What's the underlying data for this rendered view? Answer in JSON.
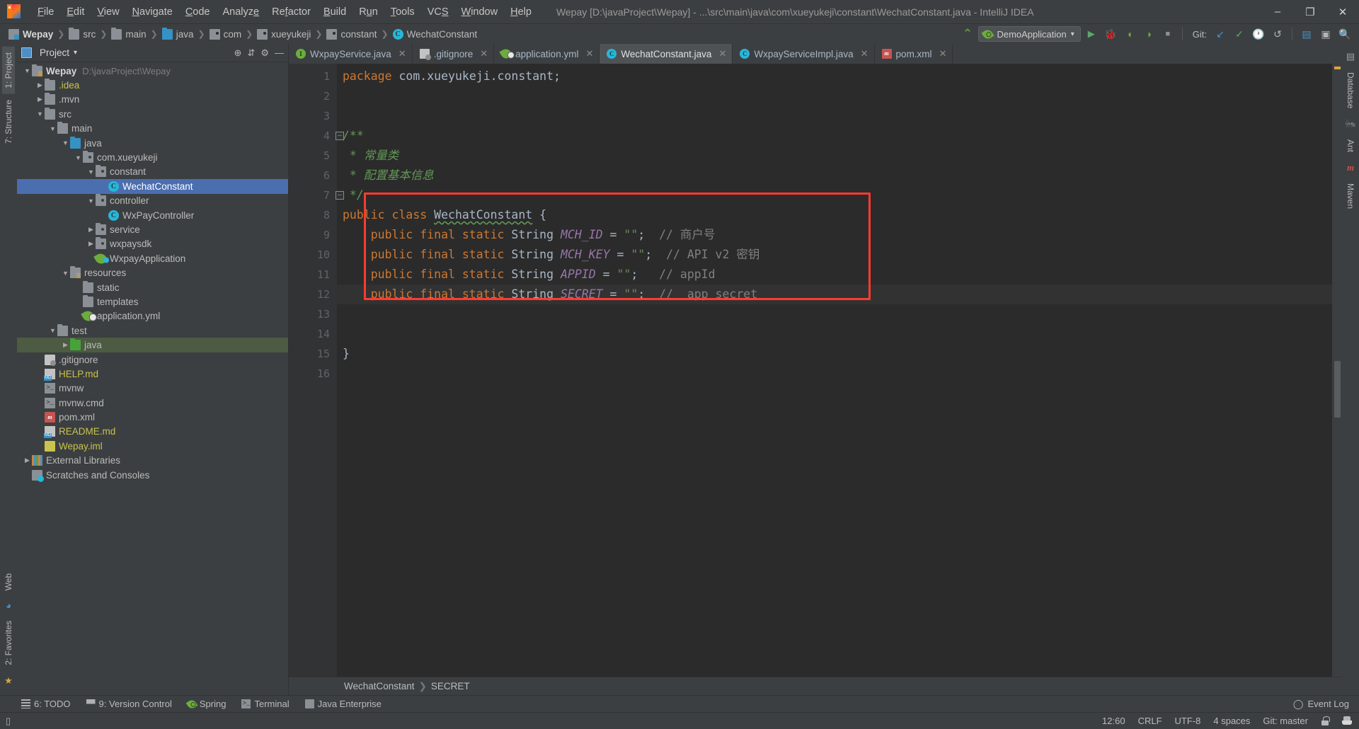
{
  "titlebar": {
    "menus": [
      "File",
      "Edit",
      "View",
      "Navigate",
      "Code",
      "Analyze",
      "Refactor",
      "Build",
      "Run",
      "Tools",
      "VCS",
      "Window",
      "Help"
    ],
    "window_title": "Wepay [D:\\javaProject\\Wepay] - ...\\src\\main\\java\\com\\xueyukeji\\constant\\WechatConstant.java - IntelliJ IDEA",
    "minimize": "–",
    "maximize": "❐",
    "close": "✕"
  },
  "navbar": {
    "crumbs": [
      {
        "label": "Wepay",
        "icon": "project-icon"
      },
      {
        "label": "src",
        "icon": "folder-icon"
      },
      {
        "label": "main",
        "icon": "folder-icon"
      },
      {
        "label": "java",
        "icon": "source-folder-icon"
      },
      {
        "label": "com",
        "icon": "package-icon"
      },
      {
        "label": "xueyukeji",
        "icon": "package-icon"
      },
      {
        "label": "constant",
        "icon": "package-icon"
      },
      {
        "label": "WechatConstant",
        "icon": "class-icon"
      }
    ],
    "separator": "❯",
    "run_config": "DemoApplication",
    "run_config_caret": "▾",
    "git_label": "Git:",
    "buttons": {
      "run": "▶",
      "debug": "debug-icon",
      "coverage": "coverage-icon",
      "profile": "profile-icon",
      "stop": "■",
      "updateproject": "update-icon",
      "commit": "✓",
      "history": "history-icon",
      "rollback": "↺",
      "search": "search-icon"
    }
  },
  "left_strip": {
    "project": "1: Project",
    "structure": "7: Structure",
    "web": "Web",
    "favorites": "2: Favorites"
  },
  "right_strip": {
    "database": "Database",
    "ant": "Ant",
    "maven": "Maven"
  },
  "project_panel": {
    "title": "Project",
    "caret": "▾",
    "icons": [
      "locate-icon",
      "collapse-all-icon",
      "settings-icon",
      "hide-icon"
    ],
    "tree": [
      {
        "label": "Wepay",
        "path": "D:\\javaProject\\Wepay",
        "indent": 0,
        "arrow": "▼",
        "icon": "module-icon",
        "style": "bold"
      },
      {
        "label": ".idea",
        "indent": 1,
        "arrow": "▶",
        "icon": "folder-icon",
        "style": "yellow"
      },
      {
        "label": ".mvn",
        "indent": 1,
        "arrow": "▶",
        "icon": "folder-icon",
        "style": ""
      },
      {
        "label": "src",
        "indent": 1,
        "arrow": "▼",
        "icon": "folder-icon",
        "style": ""
      },
      {
        "label": "main",
        "indent": 2,
        "arrow": "▼",
        "icon": "folder-icon",
        "style": ""
      },
      {
        "label": "java",
        "indent": 3,
        "arrow": "▼",
        "icon": "source-folder-icon",
        "style": ""
      },
      {
        "label": "com.xueyukeji",
        "indent": 4,
        "arrow": "▼",
        "icon": "package-icon",
        "style": ""
      },
      {
        "label": "constant",
        "indent": 5,
        "arrow": "▼",
        "icon": "package-icon",
        "style": ""
      },
      {
        "label": "WechatConstant",
        "indent": 6,
        "arrow": "",
        "icon": "class-icon",
        "style": "selected"
      },
      {
        "label": "controller",
        "indent": 5,
        "arrow": "▼",
        "icon": "package-icon",
        "style": ""
      },
      {
        "label": "WxPayController",
        "indent": 6,
        "arrow": "",
        "icon": "class-icon",
        "style": ""
      },
      {
        "label": "service",
        "indent": 5,
        "arrow": "▶",
        "icon": "package-icon",
        "style": ""
      },
      {
        "label": "wxpaysdk",
        "indent": 5,
        "arrow": "▶",
        "icon": "package-icon",
        "style": ""
      },
      {
        "label": "WxpayApplication",
        "indent": 5,
        "arrow": "",
        "icon": "spring-class-icon",
        "style": ""
      },
      {
        "label": "resources",
        "indent": 3,
        "arrow": "▼",
        "icon": "resources-folder-icon",
        "style": ""
      },
      {
        "label": "static",
        "indent": 4,
        "arrow": "",
        "icon": "folder-icon",
        "style": ""
      },
      {
        "label": "templates",
        "indent": 4,
        "arrow": "",
        "icon": "folder-icon",
        "style": ""
      },
      {
        "label": "application.yml",
        "indent": 4,
        "arrow": "",
        "icon": "spring-yaml-icon",
        "style": ""
      },
      {
        "label": "test",
        "indent": 2,
        "arrow": "▼",
        "icon": "folder-icon",
        "style": ""
      },
      {
        "label": "java",
        "indent": 3,
        "arrow": "▶",
        "icon": "test-source-folder-icon",
        "style": "greenbg"
      },
      {
        "label": ".gitignore",
        "indent": 1,
        "arrow": "",
        "icon": "gitignore-icon",
        "style": ""
      },
      {
        "label": "HELP.md",
        "indent": 1,
        "arrow": "",
        "icon": "markdown-icon",
        "style": "yellow"
      },
      {
        "label": "mvnw",
        "indent": 1,
        "arrow": "",
        "icon": "shell-script-icon",
        "style": ""
      },
      {
        "label": "mvnw.cmd",
        "indent": 1,
        "arrow": "",
        "icon": "shell-script-icon",
        "style": ""
      },
      {
        "label": "pom.xml",
        "indent": 1,
        "arrow": "",
        "icon": "maven-pom-icon",
        "style": ""
      },
      {
        "label": "README.md",
        "indent": 1,
        "arrow": "",
        "icon": "markdown-icon",
        "style": "yellow"
      },
      {
        "label": "Wepay.iml",
        "indent": 1,
        "arrow": "",
        "icon": "iml-icon",
        "style": "yellow"
      },
      {
        "label": "External Libraries",
        "indent": 0,
        "arrow": "▶",
        "icon": "libraries-icon",
        "style": ""
      },
      {
        "label": "Scratches and Consoles",
        "indent": 0,
        "arrow": "",
        "icon": "scratches-icon",
        "style": ""
      }
    ]
  },
  "editor_tabs": [
    {
      "label": "WxpayService.java",
      "icon": "interface-icon",
      "active": false,
      "close": "✕"
    },
    {
      "label": ".gitignore",
      "icon": "gitignore-icon",
      "active": false,
      "close": "✕"
    },
    {
      "label": "application.yml",
      "icon": "spring-yaml-icon",
      "active": false,
      "close": "✕"
    },
    {
      "label": "WechatConstant.java",
      "icon": "class-icon",
      "active": true,
      "close": "✕"
    },
    {
      "label": "WxpayServiceImpl.java",
      "icon": "class-icon",
      "active": false,
      "close": "✕"
    },
    {
      "label": "pom.xml",
      "icon": "maven-pom-icon",
      "active": false,
      "close": "✕"
    }
  ],
  "code": {
    "line_numbers": [
      "1",
      "2",
      "3",
      "4",
      "5",
      "6",
      "7",
      "8",
      "9",
      "10",
      "11",
      "12",
      "13",
      "14",
      "15",
      "16"
    ],
    "lines": [
      {
        "n": 1,
        "segments": [
          {
            "t": "package ",
            "c": "kw"
          },
          {
            "t": "com.xueyukeji.constant;",
            "c": "punct"
          }
        ]
      },
      {
        "n": 2,
        "segments": []
      },
      {
        "n": 3,
        "segments": []
      },
      {
        "n": 4,
        "segments": [
          {
            "t": "/**",
            "c": "doc"
          }
        ],
        "fold": "–"
      },
      {
        "n": 5,
        "segments": [
          {
            "t": " * 常量类",
            "c": "doc"
          }
        ]
      },
      {
        "n": 6,
        "segments": [
          {
            "t": " * 配置基本信息",
            "c": "doc"
          }
        ]
      },
      {
        "n": 7,
        "segments": [
          {
            "t": " */",
            "c": "doc"
          }
        ],
        "fold": "–"
      },
      {
        "n": 8,
        "segments": [
          {
            "t": "public class ",
            "c": "kw"
          },
          {
            "t": "WechatConstant",
            "c": "wavy"
          },
          {
            "t": " {",
            "c": "punct"
          }
        ]
      },
      {
        "n": 9,
        "segments": [
          {
            "t": "    public final static ",
            "c": "kw"
          },
          {
            "t": "String ",
            "c": "punct"
          },
          {
            "t": "MCH_ID",
            "c": "sfield"
          },
          {
            "t": " = ",
            "c": "punct"
          },
          {
            "t": "\"\"",
            "c": "str"
          },
          {
            "t": ";  ",
            "c": "punct"
          },
          {
            "t": "// 商户号",
            "c": "cmt"
          }
        ]
      },
      {
        "n": 10,
        "segments": [
          {
            "t": "    public final static ",
            "c": "kw"
          },
          {
            "t": "String ",
            "c": "punct"
          },
          {
            "t": "MCH_KEY",
            "c": "sfield"
          },
          {
            "t": " = ",
            "c": "punct"
          },
          {
            "t": "\"\"",
            "c": "str"
          },
          {
            "t": ";  ",
            "c": "punct"
          },
          {
            "t": "// API v2 密钥",
            "c": "cmt"
          }
        ]
      },
      {
        "n": 11,
        "segments": [
          {
            "t": "    public final static ",
            "c": "kw"
          },
          {
            "t": "String ",
            "c": "punct"
          },
          {
            "t": "APPID",
            "c": "sfield"
          },
          {
            "t": " = ",
            "c": "punct"
          },
          {
            "t": "\"\"",
            "c": "str"
          },
          {
            "t": ";   ",
            "c": "punct"
          },
          {
            "t": "// appId",
            "c": "cmt"
          }
        ]
      },
      {
        "n": 12,
        "segments": [
          {
            "t": "    public final static ",
            "c": "kw"
          },
          {
            "t": "String ",
            "c": "punct"
          },
          {
            "t": "SECRET",
            "c": "sfield"
          },
          {
            "t": " = ",
            "c": "punct"
          },
          {
            "t": "\"\"",
            "c": "str"
          },
          {
            "t": ";  ",
            "c": "punct"
          },
          {
            "t": "//  app secret",
            "c": "cmt"
          }
        ]
      },
      {
        "n": 13,
        "segments": []
      },
      {
        "n": 14,
        "segments": []
      },
      {
        "n": 15,
        "segments": [
          {
            "t": "}",
            "c": "punct"
          }
        ]
      },
      {
        "n": 16,
        "segments": []
      }
    ],
    "current_line": 12,
    "highlight_box": {
      "color": "#ff3b30"
    }
  },
  "editor_breadcrumb": {
    "class": "WechatConstant",
    "separator": "❯",
    "member": "SECRET"
  },
  "bottom_toolwindows": [
    {
      "label": "6: TODO",
      "accel": "6",
      "icon": "todo-icon"
    },
    {
      "label": "9: Version Control",
      "accel": "9",
      "icon": "vcs-icon"
    },
    {
      "label": "Spring",
      "accel": "",
      "icon": "spring-icon"
    },
    {
      "label": "Terminal",
      "accel": "",
      "icon": "terminal-icon"
    },
    {
      "label": "Java Enterprise",
      "accel": "",
      "icon": "java-enterprise-icon"
    }
  ],
  "event_log": "Event Log",
  "statusbar": {
    "position": "12:60",
    "line_separator": "CRLF",
    "encoding": "UTF-8",
    "indent": "4 spaces",
    "branch": "Git: master",
    "lock": "lock-icon",
    "inspection": "hector-icon"
  },
  "colors": {
    "accent_red": "#ff3b30",
    "selection_blue": "#4b6eaf",
    "panel_bg": "#3c3f41",
    "editor_bg": "#2b2b2b",
    "gutter_bg": "#313335",
    "keyword": "#cc7832",
    "string": "#6a8759",
    "comment": "#808080",
    "javadoc": "#629755",
    "static_field": "#9876aa"
  }
}
